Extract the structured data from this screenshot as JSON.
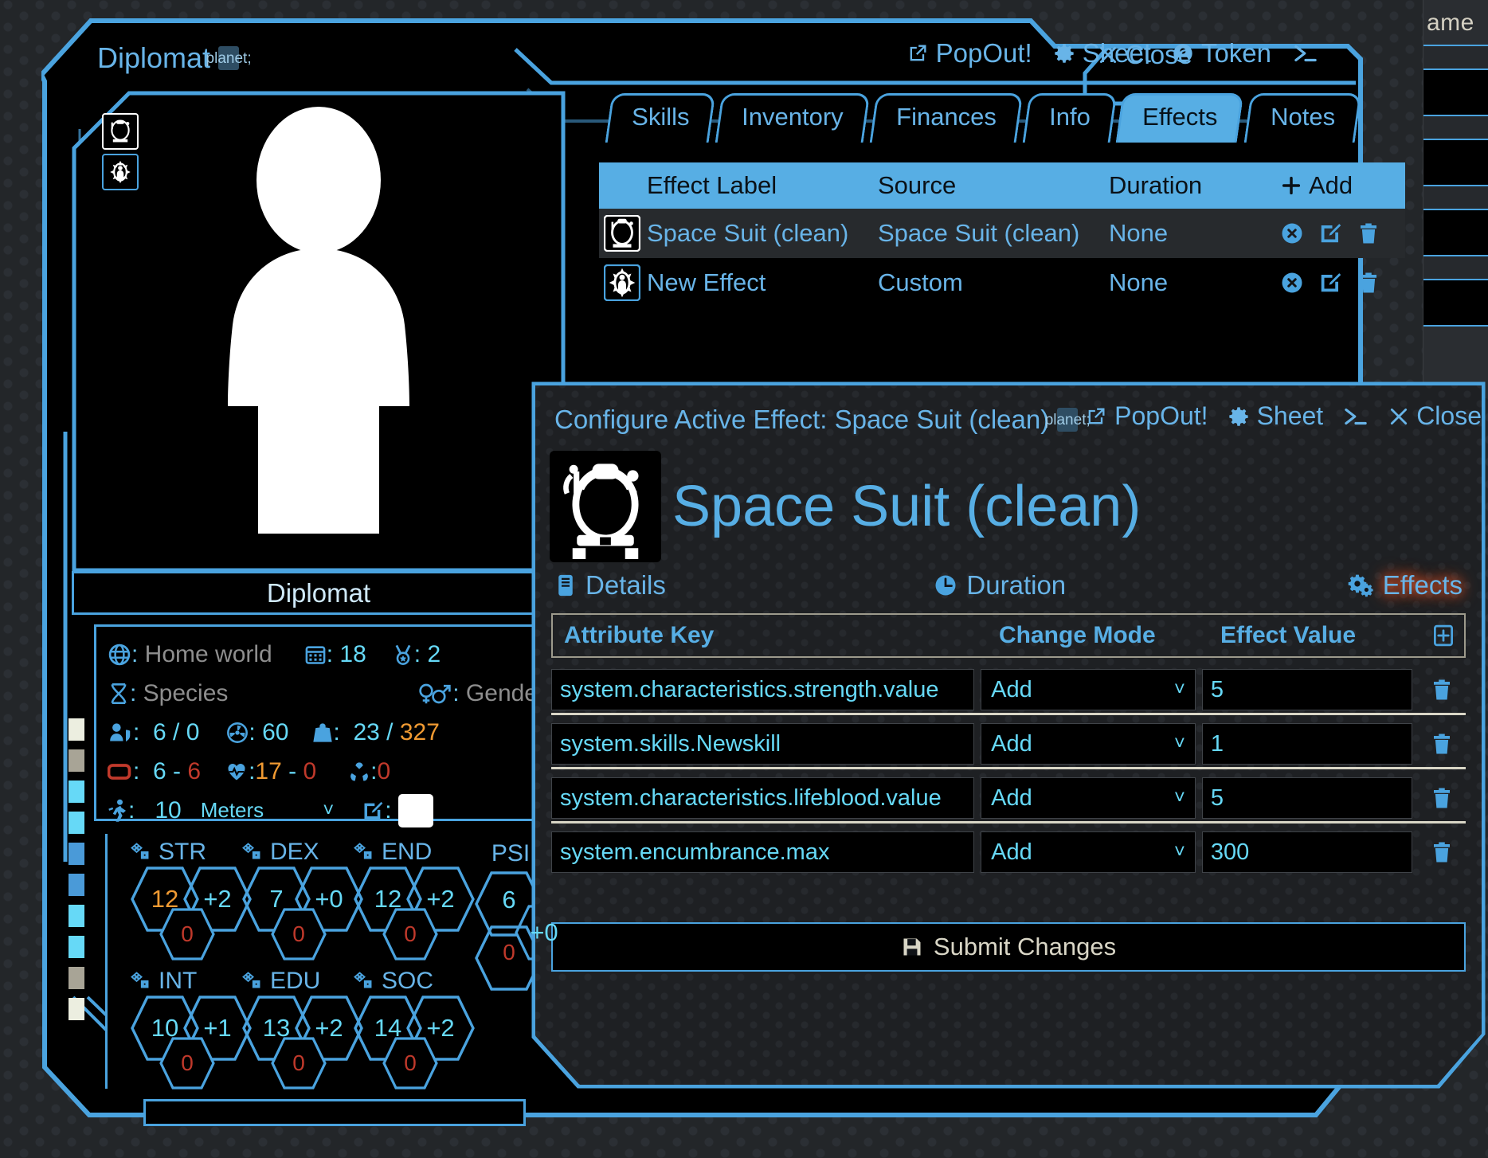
{
  "background_sheet": {
    "title_fragment": "ame"
  },
  "character_window": {
    "title": "Diplomat",
    "title_badge_icon": "globe-badge-icon",
    "controls": [
      {
        "icon": "popout-icon",
        "label": "PopOut!"
      },
      {
        "icon": "gear-icon",
        "label": "Sheet"
      },
      {
        "icon": "token-user-icon",
        "label": "Token"
      },
      {
        "icon": "console-icon",
        "label": ""
      }
    ],
    "close_label": "Close",
    "tabs": [
      {
        "label": "Skills",
        "active": false
      },
      {
        "label": "Inventory",
        "active": false
      },
      {
        "label": "Finances",
        "active": false
      },
      {
        "label": "Info",
        "active": false
      },
      {
        "label": "Effects",
        "active": true
      },
      {
        "label": "Notes",
        "active": false
      }
    ],
    "portrait": {
      "name_plate": "Diplomat",
      "effect_chips": [
        {
          "icon": "space-helmet-icon",
          "selected": false
        },
        {
          "icon": "radiant-person-icon",
          "selected": true
        }
      ]
    },
    "stats": {
      "home_world": {
        "icon": "globe-icon",
        "label": "Home world"
      },
      "age": {
        "icon": "calendar-icon",
        "value": "18"
      },
      "rank": {
        "icon": "medal-icon",
        "value": "2"
      },
      "species": {
        "icon": "dna-icon",
        "label": "Species"
      },
      "gender": {
        "icon": "gender-icon",
        "label": "Gender"
      },
      "armour": {
        "icon": "person-shield-icon",
        "value": "6 / 0"
      },
      "radiation": {
        "icon": "radiation-circle-icon",
        "value": "60"
      },
      "encumbrance": {
        "icon": "weight-icon",
        "current": "23",
        "sep": "/",
        "max": "327"
      },
      "battery": {
        "icon": "battery-icon",
        "current": "6",
        "sep": "-",
        "max": "6"
      },
      "lifeblood": {
        "icon": "heartbeat-icon",
        "current": "17",
        "sep": "-",
        "damage": "0"
      },
      "rads": {
        "icon": "radiation-drop-icon",
        "value": "0"
      },
      "speed": {
        "icon": "running-icon",
        "value": "10",
        "unit": "Meters",
        "unit_caret": "chevron-down-icon"
      },
      "edit": {
        "icon": "edit-square-icon",
        "swatch": "#ffffff"
      }
    },
    "characteristics": [
      {
        "key": "STR",
        "value": "12",
        "mod": "+2",
        "dmg": "0",
        "value_color": "#f09a32"
      },
      {
        "key": "DEX",
        "value": "7",
        "mod": "+0",
        "dmg": "0",
        "value_color": "#66d9f7"
      },
      {
        "key": "END",
        "value": "12",
        "mod": "+2",
        "dmg": "0",
        "value_color": "#66d9f7"
      },
      {
        "key": "INT",
        "value": "10",
        "mod": "+1",
        "dmg": "0",
        "value_color": "#66d9f7"
      },
      {
        "key": "EDU",
        "value": "13",
        "mod": "+2",
        "dmg": "0",
        "value_color": "#66d9f7"
      },
      {
        "key": "SOC",
        "value": "14",
        "mod": "+2",
        "dmg": "0",
        "value_color": "#66d9f7"
      }
    ],
    "psi": {
      "label": "PSI",
      "value": "6",
      "mod": "+0",
      "dmg": "0"
    },
    "chip_strip": [
      "#eceee0",
      "#a8a496",
      "#66d9f7",
      "#66d9f7",
      "#4a9ad8",
      "#4a9ad8",
      "#66d9f7",
      "#66d9f7",
      "#a8a496",
      "#eceee0"
    ]
  },
  "effects_tab": {
    "columns": {
      "label": "Effect Label",
      "source": "Source",
      "duration": "Duration",
      "add": "Add",
      "add_icon": "plus-icon"
    },
    "rows": [
      {
        "icon": "space-helmet-icon",
        "label": "Space Suit (clean)",
        "source": "Space Suit (clean)",
        "duration": "None",
        "actions": [
          "disable-icon",
          "edit-icon",
          "delete-icon"
        ],
        "highlighted": true
      },
      {
        "icon": "radiant-person-icon",
        "label": "New Effect",
        "source": "Custom",
        "duration": "None",
        "actions": [
          "disable-icon",
          "edit-icon",
          "delete-icon"
        ],
        "highlighted": false
      }
    ]
  },
  "configure_dialog": {
    "title": "Configure Active Effect: Space Suit (clean)",
    "title_badge_icon": "globe-badge-icon",
    "controls": [
      {
        "icon": "popout-icon",
        "label": "PopOut!"
      },
      {
        "icon": "gear-icon",
        "label": "Sheet"
      },
      {
        "icon": "console-icon",
        "label": ""
      },
      {
        "icon": "close-icon",
        "label": "Close"
      }
    ],
    "effect_name": "Space Suit (clean)",
    "effect_icon": "space-helmet-icon",
    "tabs": [
      {
        "label": "Details",
        "icon": "details-icon",
        "active": false
      },
      {
        "label": "Duration",
        "icon": "clock-icon",
        "active": false
      },
      {
        "label": "Effects",
        "icon": "gears-icon",
        "active": true
      }
    ],
    "table": {
      "headers": {
        "key": "Attribute Key",
        "mode": "Change Mode",
        "value": "Effect Value",
        "add_icon": "add-row-icon"
      },
      "rows": [
        {
          "key": "system.characteristics.strength.value",
          "mode": "Add",
          "value": "5",
          "delete_icon": "delete-icon"
        },
        {
          "key": "system.skills.Newskill",
          "mode": "Add",
          "value": "1",
          "delete_icon": "delete-icon"
        },
        {
          "key": "system.characteristics.lifeblood.value",
          "mode": "Add",
          "value": "5",
          "delete_icon": "delete-icon"
        },
        {
          "key": "system.encumbrance.max",
          "mode": "Add",
          "value": "300",
          "delete_icon": "delete-icon"
        }
      ]
    },
    "submit": {
      "label": "Submit Changes",
      "icon": "save-icon"
    }
  },
  "colors": {
    "accent": "#4aa3df",
    "accent_light": "#68b4e8",
    "header_fill": "#57aee4",
    "cyan": "#66d9f7",
    "orange": "#f09a32",
    "red": "#c0392b",
    "cream": "#d9d6c6"
  }
}
